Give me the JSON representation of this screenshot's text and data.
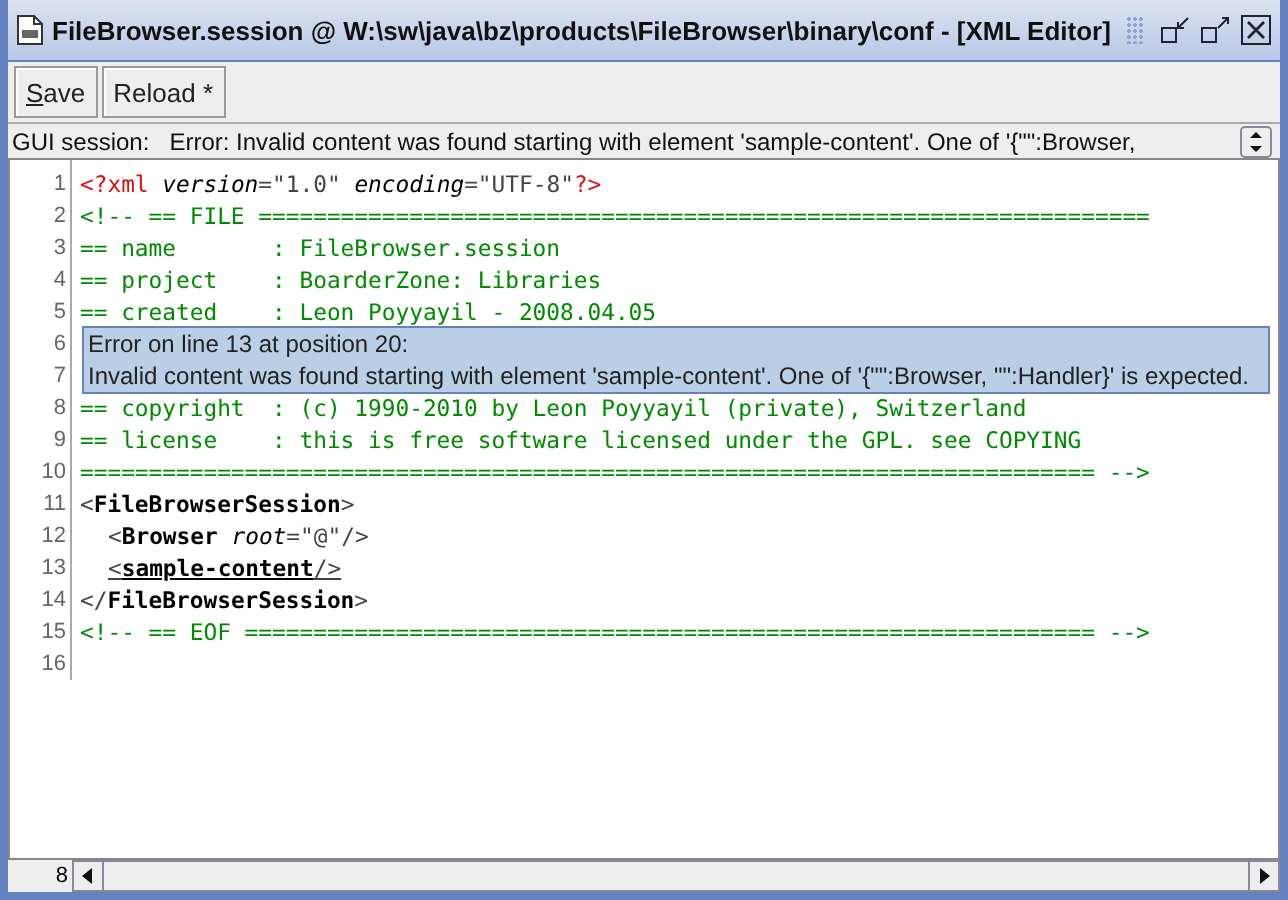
{
  "window": {
    "title": "FileBrowser.session @ W:\\sw\\java\\bz\\products\\FileBrowser\\binary\\conf - [XML Editor]"
  },
  "toolbar": {
    "buttons": [
      {
        "label": "Save",
        "mnemonic": true
      },
      {
        "label": "Reload *"
      }
    ]
  },
  "status": {
    "label": "GUI session:",
    "message": "Error: Invalid content was found starting with element 'sample-content'. One of '{\"\":Browser,"
  },
  "editor": {
    "lines": [
      {
        "number": "1",
        "segments": [
          {
            "kind": "pi",
            "text": "<?xml"
          },
          {
            "kind": "attr",
            "text": " version"
          },
          {
            "kind": "punct",
            "text": "=\"1.0\" "
          },
          {
            "kind": "attr",
            "text": "encoding"
          },
          {
            "kind": "punct",
            "text": "=\"UTF-8\""
          },
          {
            "kind": "pi",
            "text": "?>"
          }
        ]
      },
      {
        "number": "2",
        "segments": [
          {
            "kind": "comment",
            "text": "<!-- == FILE ================================================================="
          }
        ]
      },
      {
        "number": "3",
        "segments": [
          {
            "kind": "comment",
            "text": "== name       : FileBrowser.session"
          }
        ]
      },
      {
        "number": "4",
        "segments": [
          {
            "kind": "comment",
            "text": "== project    : BoarderZone: Libraries"
          }
        ]
      },
      {
        "number": "5",
        "segments": [
          {
            "kind": "comment",
            "text": "== created    : Leon Poyyayil - 2008.04.05"
          }
        ]
      },
      {
        "number": "6"
      },
      {
        "number": "7"
      },
      {
        "number": "8",
        "segments": [
          {
            "kind": "comment",
            "text": "== copyright  : (c) 1990-2010 by Leon Poyyayil (private), Switzerland"
          }
        ]
      },
      {
        "number": "9",
        "segments": [
          {
            "kind": "comment",
            "text": "== license    : this is free software licensed under the GPL. see COPYING"
          }
        ]
      },
      {
        "number": "10",
        "segments": [
          {
            "kind": "comment",
            "text": "========================================================================== -->"
          }
        ]
      },
      {
        "number": "11",
        "segments": [
          {
            "kind": "punct",
            "text": "<"
          },
          {
            "kind": "tag",
            "text": "FileBrowserSession"
          },
          {
            "kind": "punct",
            "text": ">"
          }
        ]
      },
      {
        "number": "12",
        "indent": true,
        "segments": [
          {
            "kind": "punct",
            "text": "<"
          },
          {
            "kind": "tag",
            "text": "Browser"
          },
          {
            "kind": "attr",
            "text": " root"
          },
          {
            "kind": "punct",
            "text": "=\"@\"/>"
          }
        ]
      },
      {
        "number": "13",
        "indent": true,
        "segments": [
          {
            "kind": "error",
            "text": "<"
          },
          {
            "kind": "errortag",
            "text": "sample-content"
          },
          {
            "kind": "error",
            "text": "/>"
          }
        ]
      },
      {
        "number": "14",
        "segments": [
          {
            "kind": "punct",
            "text": "</"
          },
          {
            "kind": "tag",
            "text": "FileBrowserSession"
          },
          {
            "kind": "punct",
            "text": ">"
          }
        ]
      },
      {
        "number": "15",
        "segments": [
          {
            "kind": "comment",
            "text": "<!-- == EOF ============================================================== -->"
          }
        ]
      },
      {
        "number": "16"
      }
    ],
    "tooltip": {
      "title": "Error on line 13 at position 20:",
      "message": "Invalid content was found starting with element 'sample-content'. One of '{\"\":Browser, \"\":Handler}' is expected."
    },
    "column_indicator": "8"
  }
}
